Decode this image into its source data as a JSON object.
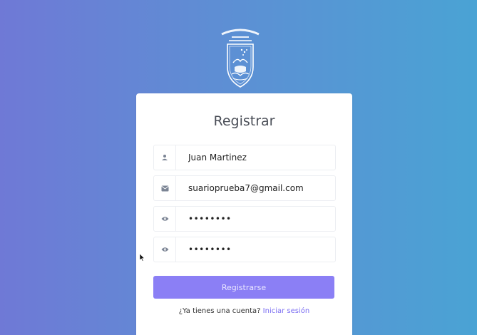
{
  "card": {
    "title": "Registrar"
  },
  "fields": {
    "name": {
      "value": "Juan Martinez",
      "icon": "user-icon"
    },
    "email": {
      "value": "suarioprueba7@gmail.com",
      "icon": "envelope-icon"
    },
    "password": {
      "value": "12345678",
      "icon": "eye-icon"
    },
    "confirm_password": {
      "value": "12345678",
      "icon": "eye-icon"
    }
  },
  "submit": {
    "label": "Registrarse"
  },
  "footer": {
    "prompt": "¿Ya tienes una cuenta?",
    "link": "Iniciar sesión"
  },
  "colors": {
    "accent": "#8b7ff5",
    "link": "#7b6ef2",
    "gradient_start": "#6f79d6",
    "gradient_end": "#4aa3d4"
  }
}
